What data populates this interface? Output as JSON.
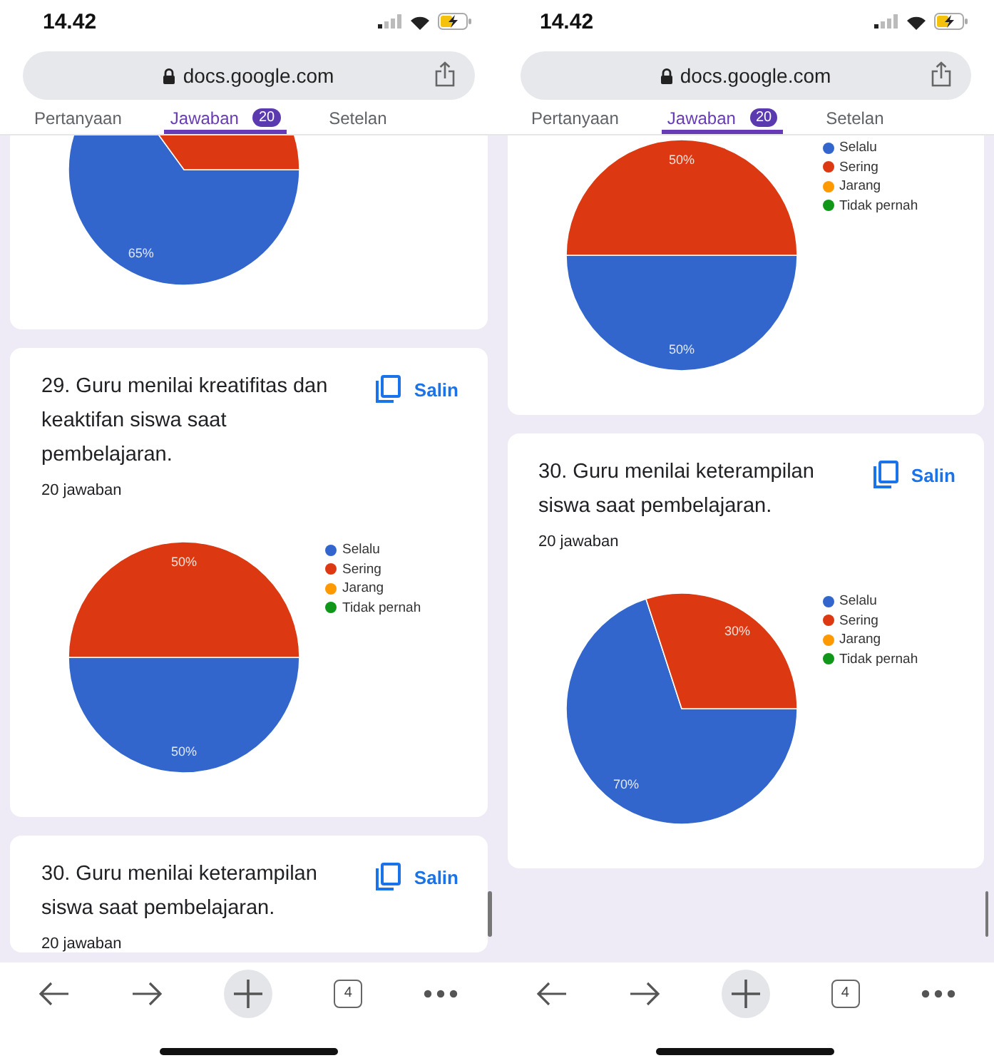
{
  "screens": [
    {
      "status": {
        "time": "14.42"
      },
      "address": {
        "url": "docs.google.com"
      },
      "tabs": [
        {
          "label": "Pertanyaan",
          "selected": false
        },
        {
          "label": "Jawaban",
          "badge": "20",
          "selected": true
        },
        {
          "label": "Setelan",
          "selected": false
        }
      ],
      "cards": [
        {
          "clipped_top": true,
          "chart_data": {
            "type": "pie",
            "values": [
              65,
              35
            ],
            "colors": [
              "#3366cc",
              "#dc3912"
            ],
            "value_labels": [
              "65%",
              null
            ]
          }
        },
        {
          "clipped_top": false,
          "question": "29. Guru menilai kreatifitas dan keaktifan siswa saat pembelajaran.",
          "copy_label": "Salin",
          "responses": "20 jawaban",
          "chart_data": {
            "type": "pie",
            "categories": [
              "Selalu",
              "Sering",
              "Jarang",
              "Tidak pernah"
            ],
            "values": [
              50,
              50,
              0,
              0
            ],
            "colors": [
              "#3366cc",
              "#dc3912",
              "#ff9900",
              "#109618"
            ],
            "value_labels": [
              "50%",
              "50%",
              null,
              null
            ],
            "legend": "right"
          }
        },
        {
          "clipped_top": false,
          "question": "30. Guru menilai keterampilan siswa saat pembelajaran.",
          "copy_label": "Salin",
          "responses": "20 jawaban"
        }
      ],
      "toolbar": {
        "tab_count": "4"
      }
    },
    {
      "status": {
        "time": "14.42"
      },
      "address": {
        "url": "docs.google.com"
      },
      "tabs": [
        {
          "label": "Pertanyaan",
          "selected": false
        },
        {
          "label": "Jawaban",
          "badge": "20",
          "selected": true
        },
        {
          "label": "Setelan",
          "selected": false
        }
      ],
      "cards": [
        {
          "clipped_top": true,
          "chart_data": {
            "type": "pie",
            "categories": [
              "Selalu",
              "Sering",
              "Jarang",
              "Tidak pernah"
            ],
            "values": [
              50,
              50,
              0,
              0
            ],
            "colors": [
              "#3366cc",
              "#dc3912",
              "#ff9900",
              "#109618"
            ],
            "value_labels": [
              "50%",
              "50%",
              null,
              null
            ],
            "legend": "right"
          }
        },
        {
          "clipped_top": false,
          "question": "30. Guru menilai keterampilan siswa saat pembelajaran.",
          "copy_label": "Salin",
          "responses": "20 jawaban",
          "chart_data": {
            "type": "pie",
            "categories": [
              "Selalu",
              "Sering",
              "Jarang",
              "Tidak pernah"
            ],
            "values": [
              70,
              30,
              0,
              0
            ],
            "colors": [
              "#3366cc",
              "#dc3912",
              "#ff9900",
              "#109618"
            ],
            "value_labels": [
              "70%",
              "30%",
              null,
              null
            ],
            "legend": "right"
          }
        }
      ],
      "toolbar": {
        "tab_count": "4"
      }
    }
  ]
}
